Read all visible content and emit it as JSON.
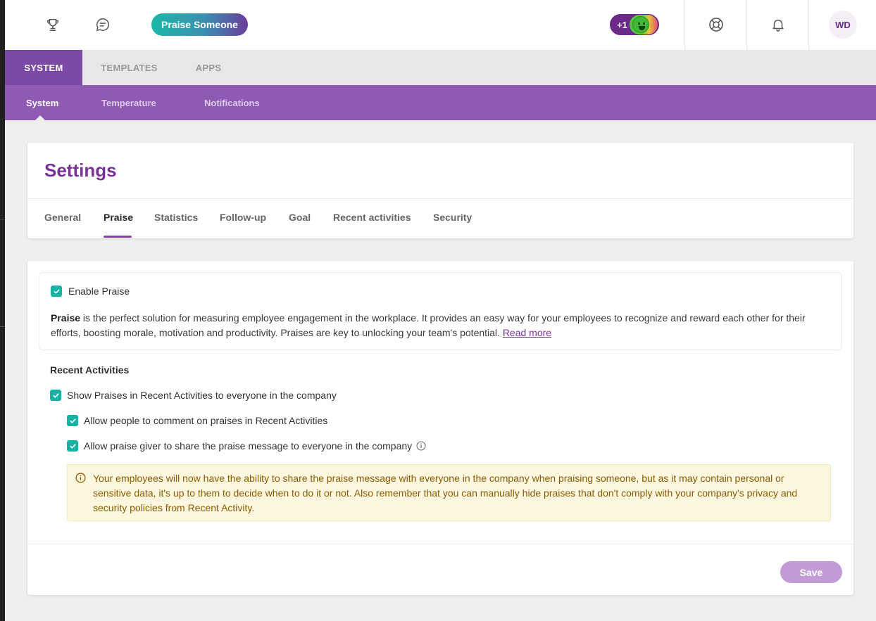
{
  "header": {
    "praise_button": "Praise Someone",
    "mood_badge": "+1",
    "avatar_initials": "WD",
    "icons": [
      "trophy-icon",
      "chat-icon",
      "lifebuoy-icon",
      "bell-icon"
    ]
  },
  "primary_tabs": [
    {
      "label": "SYSTEM",
      "active": true
    },
    {
      "label": "TEMPLATES",
      "active": false
    },
    {
      "label": "APPS",
      "active": false
    }
  ],
  "secondary_tabs": [
    {
      "label": "System",
      "active": true
    },
    {
      "label": "Temperature",
      "active": false
    },
    {
      "label": "Notifications",
      "active": false
    }
  ],
  "settings": {
    "title": "Settings",
    "tabs": [
      {
        "label": "General",
        "active": false
      },
      {
        "label": "Praise",
        "active": true
      },
      {
        "label": "Statistics",
        "active": false
      },
      {
        "label": "Follow-up",
        "active": false
      },
      {
        "label": "Goal",
        "active": false
      },
      {
        "label": "Recent activities",
        "active": false
      },
      {
        "label": "Security",
        "active": false
      }
    ]
  },
  "praise": {
    "enable_label": "Enable Praise",
    "enable_checked": true,
    "desc_bold": "Praise",
    "desc_text": " is the perfect solution for measuring employee engagement in the workplace. It provides an easy way for your employees to recognize and reward each other for their efforts, boosting morale, motivation and productivity. Praises are key to unlocking your team's potential. ",
    "read_more": "Read more"
  },
  "recent_activities": {
    "heading": "Recent Activities",
    "show_praises": {
      "label": "Show Praises in Recent Activities to everyone in the company",
      "checked": true
    },
    "allow_comment": {
      "label": "Allow people to comment on praises in Recent Activities",
      "checked": true
    },
    "allow_share": {
      "label": "Allow praise giver to share the praise message to everyone in the company",
      "checked": true
    },
    "notice": "Your employees will now have the ability to share the praise message with everyone in the company when praising someone, but as it may contain personal or sensitive data, it's up to them to decide when to do it or not. Also remember that you can manually hide praises that don't comply with your company's privacy and security policies from Recent Activity."
  },
  "footer": {
    "save_label": "Save"
  },
  "colors": {
    "brand_purple": "#7b3298",
    "tab_purple": "#8f5ab3",
    "check_teal": "#14b3a3",
    "notice_bg": "#fdf7df"
  }
}
